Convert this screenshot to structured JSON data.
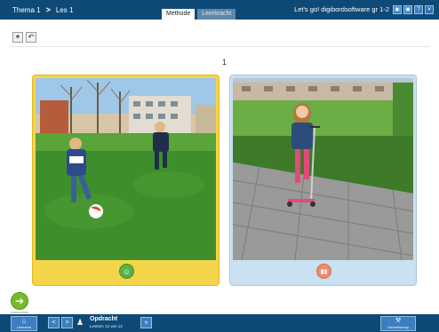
{
  "topbar": {
    "crumbs": [
      "Thema 1",
      "Les 1"
    ],
    "separator": ">",
    "tabs": {
      "methode": "Methode",
      "leerkracht": "Leerkracht"
    },
    "app_title": "Let's go! digibordsoftware gr 1-2",
    "window_buttons": [
      "▣",
      "▣",
      "?",
      "✕"
    ]
  },
  "tools": {
    "settings_glyph": "✶",
    "undo_glyph": "↶"
  },
  "page_number": "1",
  "cards": {
    "left": {
      "button_glyph": "☺",
      "icon": "smiley-icon",
      "color": "#f4d54a"
    },
    "right": {
      "button_glyph": "▮▮",
      "icon": "pause-icon",
      "color": "#c9e1f0"
    }
  },
  "fab": {
    "glyph": "➔",
    "color": "#77b92a"
  },
  "bottombar": {
    "home_label": "Lesmenu",
    "home_glyph": "⌂",
    "prev_glyph": "<",
    "next_glyph": ">",
    "person_glyph": "♟",
    "opdracht_title": "Opdracht",
    "opdracht_sub": "Lesitem 12 van 14",
    "skip_glyph": "»",
    "gereed_label": "Gereedschap",
    "gereed_glyph": "⚒"
  },
  "colors": {
    "bar": "#0f4a77",
    "accent": "#3a7fc0"
  }
}
